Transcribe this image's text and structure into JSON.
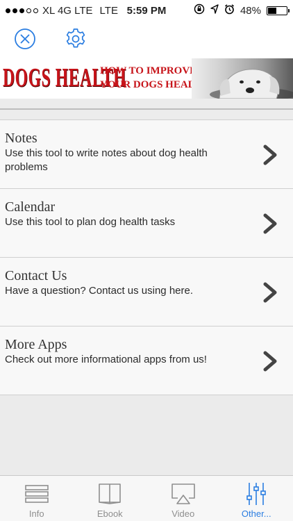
{
  "status_bar": {
    "carrier": "XL 4G LTE",
    "network": "LTE",
    "time": "5:59 PM",
    "battery": "48%",
    "battery_level": 0.48
  },
  "navbar": {
    "close_icon": "close-circle-icon",
    "settings_icon": "gear-icon",
    "accent_color": "#2a7de1"
  },
  "banner": {
    "title": "DOGS HEALTH",
    "subtitle_line1": "HOW TO IMPROVE",
    "subtitle_line2": "YOUR DOGS HEALTH"
  },
  "menu": {
    "items": [
      {
        "title": "Notes",
        "description": "Use this tool to write notes about dog health problems"
      },
      {
        "title": "Calendar",
        "description": "Use this tool to plan dog health tasks"
      },
      {
        "title": "Contact Us",
        "description": "Have a question? Contact us using here."
      },
      {
        "title": "More Apps",
        "description": "Check out more informational apps from us!"
      }
    ]
  },
  "tabbar": {
    "tabs": [
      {
        "label": "Info",
        "icon": "list-icon",
        "active": false
      },
      {
        "label": "Ebook",
        "icon": "book-icon",
        "active": false
      },
      {
        "label": "Video",
        "icon": "airplay-icon",
        "active": false
      },
      {
        "label": "Other...",
        "icon": "sliders-icon",
        "active": true
      }
    ]
  }
}
